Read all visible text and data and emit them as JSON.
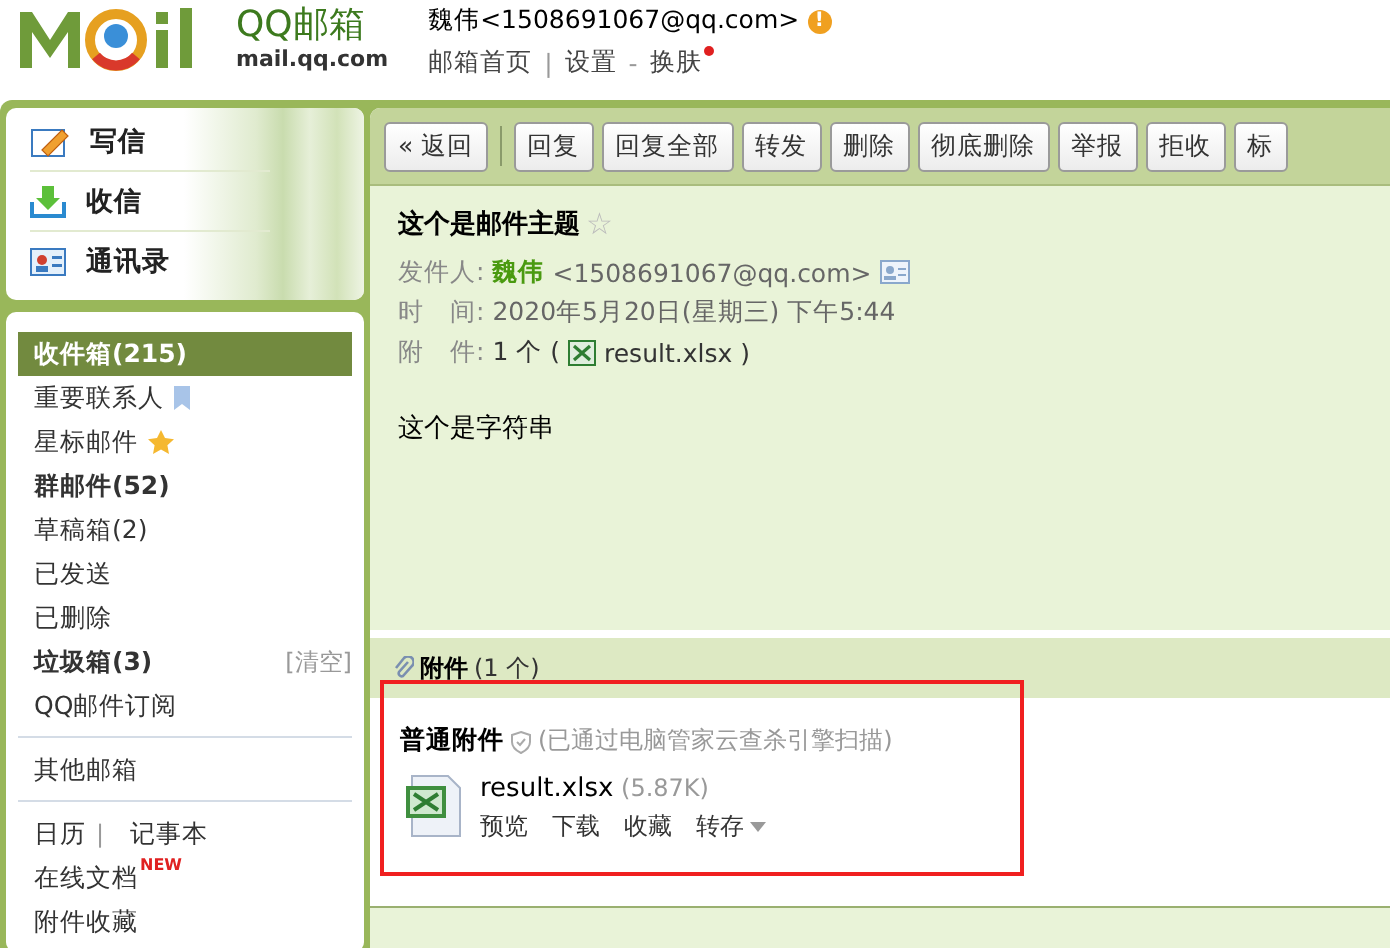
{
  "logo": {
    "brand": "QQ邮箱",
    "domain": "mail.qq.com"
  },
  "account": {
    "user": "魏伟<1508691067@qq.com>",
    "alert": "!",
    "links": [
      "邮箱首页",
      "设置",
      "换肤"
    ],
    "separators": [
      "|",
      "-"
    ],
    "skin_dot": true
  },
  "actions": [
    {
      "label": "写信"
    },
    {
      "label": "收信"
    },
    {
      "label": "通讯录"
    }
  ],
  "folder_groups": [
    {
      "items": [
        {
          "label": "收件箱(215)",
          "bold": true,
          "selected": true
        },
        {
          "label": "重要联系人",
          "bold": false,
          "selected": false
        },
        {
          "label": "星标邮件",
          "bold": false,
          "selected": false
        },
        {
          "label": "群邮件(52)",
          "bold": true,
          "selected": false
        },
        {
          "label": "草稿箱(2)",
          "bold": false,
          "selected": false
        },
        {
          "label": "已发送",
          "bold": false,
          "selected": false
        },
        {
          "label": "已删除",
          "bold": false,
          "selected": false
        },
        {
          "label": "垃圾箱(3)",
          "bold": true,
          "selected": false,
          "action": "[清空]"
        },
        {
          "label": "QQ邮件订阅",
          "bold": false,
          "selected": false
        }
      ]
    },
    {
      "items": [
        {
          "label": "其他邮箱",
          "bold": false,
          "selected": false
        }
      ]
    },
    {
      "items": [
        {
          "label": "日历",
          "bold": false,
          "selected": false,
          "separator": "|",
          "second": "记事本"
        },
        {
          "label": "在线文档",
          "bold": false,
          "selected": false,
          "badge": "NEW"
        },
        {
          "label": "附件收藏",
          "bold": false,
          "selected": false
        }
      ]
    }
  ],
  "toolbar": [
    "« 返回",
    "回复",
    "回复全部",
    "转发",
    "删除",
    "彻底删除",
    "举报",
    "拒收",
    "标"
  ],
  "message": {
    "subject": "这个是邮件主题",
    "star": "☆",
    "sender_label": "发件人:",
    "sender_name": "魏伟",
    "sender_email": "<1508691067@qq.com>",
    "time_label": "时　间:",
    "time": "2020年5月20日(星期三) 下午5:44",
    "attach_label": "附　件:",
    "attach_count": "1 个 (",
    "attach_file": "result.xlsx",
    "attach_close": ")",
    "body": "这个是字符串"
  },
  "attachments": {
    "title": "附件",
    "count": "(1 个)",
    "section": "普通附件",
    "scan_note": "(已通过电脑管家云查杀引擎扫描)",
    "files": [
      {
        "name": "result.xlsx",
        "size": "(5.87K)",
        "actions": [
          "预览",
          "下载",
          "收藏",
          "转存"
        ]
      }
    ]
  }
}
